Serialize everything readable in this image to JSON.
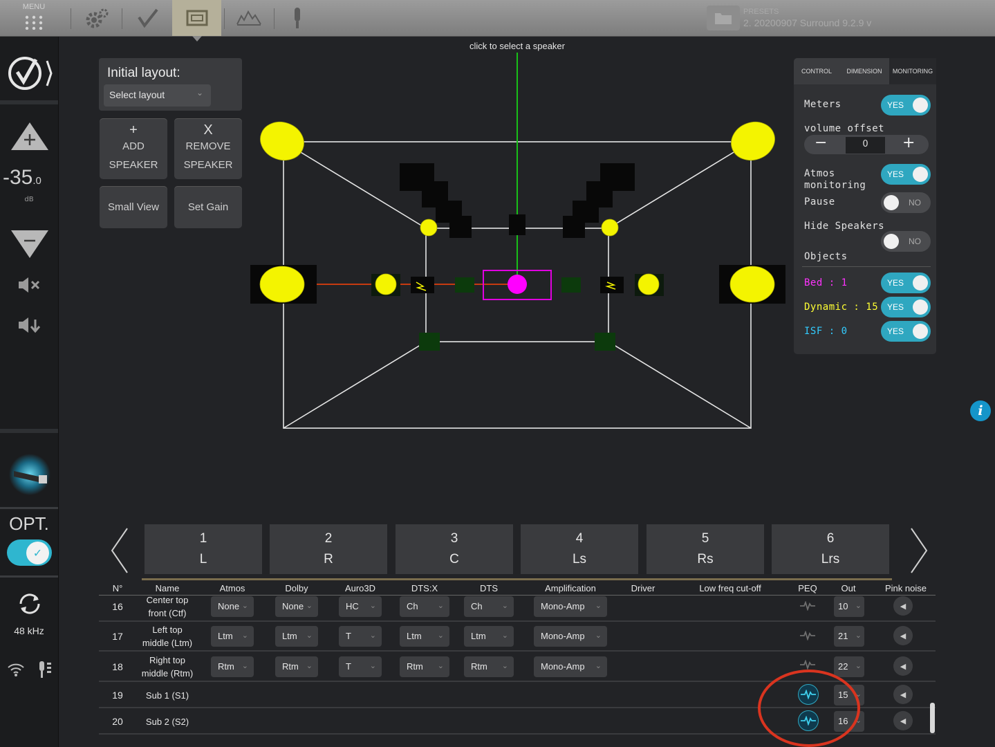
{
  "topbar": {
    "menu_label": "MENU",
    "presets_label": "PRESETS",
    "presets_value": "2. 20200907 Surround 9.2.9 v",
    "icons": [
      "menu-grid-icon",
      "settings-gear-icon",
      "checkmark-icon",
      "speaker-layout-icon",
      "eq-curve-icon",
      "microphone-icon",
      "folder-icon"
    ]
  },
  "sidebar": {
    "volume_value": "-35",
    "volume_decimal": ".0",
    "volume_unit": "dB",
    "opt_label": "OPT.",
    "opt_state": "on",
    "sample_rate": "48 kHz"
  },
  "layout_panel": {
    "title": "Initial layout:",
    "select_placeholder": "Select layout",
    "add_symbol": "+",
    "add_line1": "ADD",
    "add_line2": "SPEAKER",
    "remove_symbol": "X",
    "remove_line1": "REMOVE",
    "remove_line2": "SPEAKER",
    "small_view": "Small View",
    "set_gain": "Set Gain"
  },
  "view3d": {
    "hint": "click to select a speaker",
    "colors": {
      "speaker": "#f4f400",
      "selected": "#ff00ff",
      "line": "#e6e6e6",
      "axis_green": "#18c018",
      "axis_red": "#c63a10"
    }
  },
  "right_panel": {
    "tabs": [
      "CONTROL",
      "DIMENSION",
      "MONITORING"
    ],
    "active_tab": "MONITORING",
    "meters_label": "Meters",
    "meters_state": "YES",
    "volume_offset_label": "volume offset",
    "volume_offset_minus": "−",
    "volume_offset_value": "0",
    "volume_offset_plus": "+",
    "atmos_label_1": "Atmos",
    "atmos_label_2": "monitoring",
    "atmos_state": "YES",
    "pause_label": "Pause",
    "pause_state": "NO",
    "hide_label": "Hide Speakers",
    "hide_state": "NO",
    "objects_label": "Objects",
    "bed_label": "Bed : 1",
    "bed_state": "YES",
    "dynamic_label": "Dynamic : 15",
    "dynamic_state": "YES",
    "isf_label": "ISF : 0",
    "isf_state": "YES",
    "colors": {
      "bed": "#ff33ff",
      "dynamic": "#ffff33",
      "isf": "#33ccff",
      "toggle_on": "#2fa7c0"
    }
  },
  "speaker_tabs": [
    {
      "num": "1",
      "code": "L"
    },
    {
      "num": "2",
      "code": "R"
    },
    {
      "num": "3",
      "code": "C"
    },
    {
      "num": "4",
      "code": "Ls"
    },
    {
      "num": "5",
      "code": "Rs"
    },
    {
      "num": "6",
      "code": "Lrs"
    }
  ],
  "table": {
    "headers": [
      "N°",
      "Name",
      "Atmos",
      "Dolby",
      "Auro3D",
      "DTS:X",
      "DTS",
      "Amplification",
      "Driver",
      "Low freq cut-off",
      "PEQ",
      "Out",
      "Pink noise"
    ],
    "rows": [
      {
        "n": "16",
        "name1": "Center top",
        "name2": "front (Ctf)",
        "atmos": "None",
        "dolby": "None",
        "auro": "HC",
        "dtsx": "Ch",
        "dts": "Ch",
        "amp": "Mono-Amp",
        "out": "10",
        "peq": "off"
      },
      {
        "n": "17",
        "name1": "Left top",
        "name2": "middle (Ltm)",
        "atmos": "Ltm",
        "dolby": "Ltm",
        "auro": "T",
        "dtsx": "Ltm",
        "dts": "Ltm",
        "amp": "Mono-Amp",
        "out": "21",
        "peq": "off"
      },
      {
        "n": "18",
        "name1": "Right top",
        "name2": "middle (Rtm)",
        "atmos": "Rtm",
        "dolby": "Rtm",
        "auro": "T",
        "dtsx": "Rtm",
        "dts": "Rtm",
        "amp": "Mono-Amp",
        "out": "22",
        "peq": "off"
      },
      {
        "n": "19",
        "name1": "Sub 1 (S1)",
        "name2": "",
        "out": "15",
        "peq": "on"
      },
      {
        "n": "20",
        "name1": "Sub 2 (S2)",
        "name2": "",
        "out": "16",
        "peq": "on"
      }
    ]
  },
  "info_icon": "i",
  "annotation_color": "#d9341f"
}
